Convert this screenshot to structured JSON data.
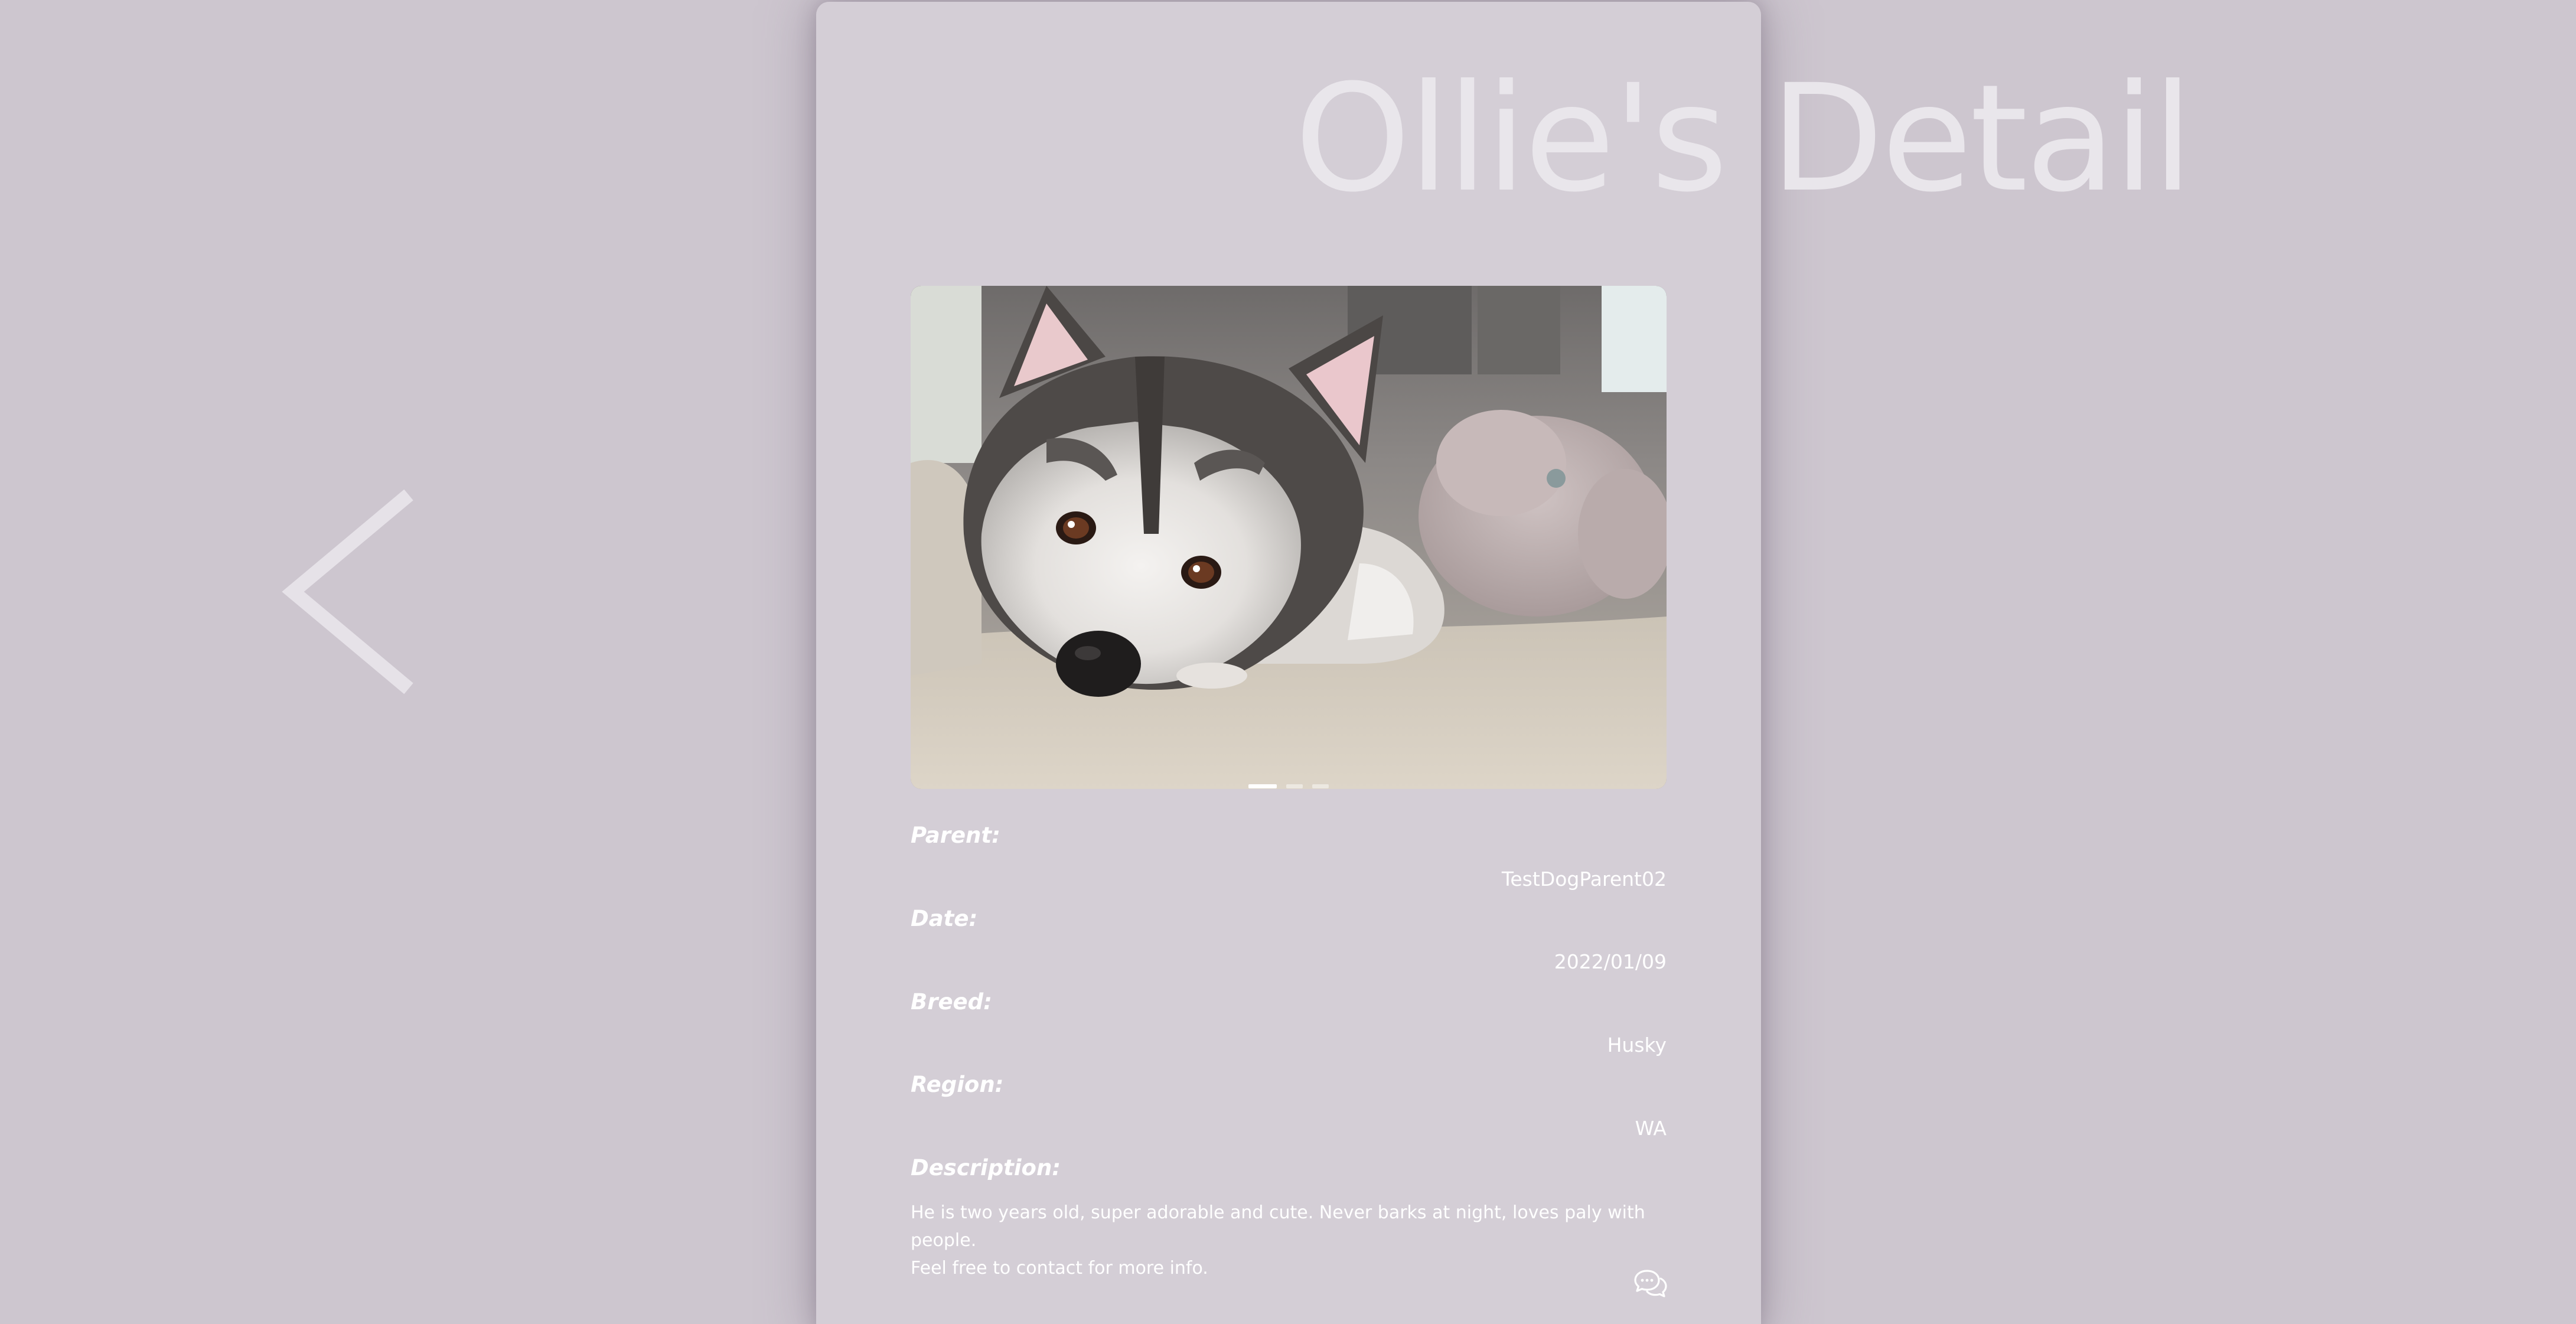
{
  "page": {
    "title": "Ollie's Detail"
  },
  "navigation": {
    "back_icon": "chevron-left-icon"
  },
  "gallery": {
    "image_subject": "Husky dog lying on a bed",
    "slide_count": 3,
    "active_slide": 1
  },
  "details": {
    "parent_label": "Parent:",
    "parent_value": "TestDogParent02",
    "date_label": "Date:",
    "date_value": "2022/01/09",
    "breed_label": "Breed:",
    "breed_value": "Husky",
    "region_label": "Region:",
    "region_value": "WA",
    "description_label": "Description:",
    "description_line1": "He is two years old, super adorable and cute. Never barks at night, loves paly with people.",
    "description_line2": "Feel free to contact for more info."
  },
  "actions": {
    "chat_icon": "chat-bubbles-icon"
  },
  "colors": {
    "background": "#cdc6cf",
    "card": "#d4ced6",
    "text": "#ffffff",
    "title": "#e9e6eb"
  }
}
